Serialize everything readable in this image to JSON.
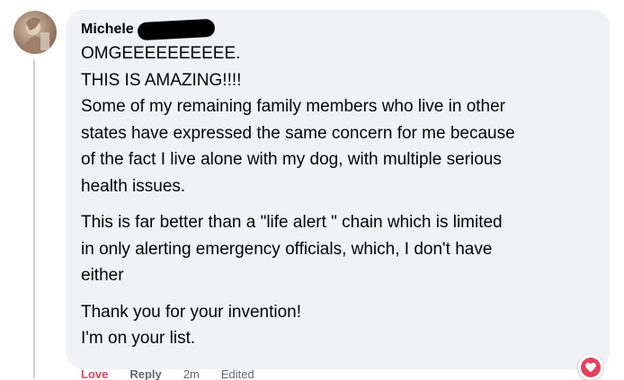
{
  "comment": {
    "author": "Michele",
    "paragraphs": [
      "OMGEEEEEEEEEE.\nTHIS IS AMAZING!!!!\nSome of my remaining family members who live in other\nstates have expressed the same concern for me because\nof the fact I live alone with my dog, with multiple serious\nhealth issues.",
      "This is far better than a \"life alert \" chain which is limited\nin only alerting emergency officials, which, I don't have\neither",
      "Thank you for your invention!\nI'm on your list."
    ],
    "actions": {
      "love": "Love",
      "reply": "Reply",
      "time": "2m",
      "edited": "Edited"
    },
    "reaction_icon": "heart-face-icon",
    "colors": {
      "bubble": "#f0f2f5",
      "text": "#050505",
      "meta": "#65676b",
      "reaction": "#e4425d"
    }
  }
}
